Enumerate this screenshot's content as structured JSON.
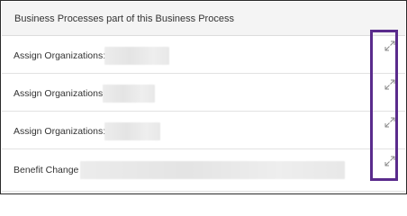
{
  "panel": {
    "title": "Business Processes part of this Business Process"
  },
  "rows": [
    {
      "label": "Assign Organizations:",
      "value": "",
      "icon": "expand-icon"
    },
    {
      "label": "Assign Organizations:",
      "value": "",
      "icon": "expand-icon"
    },
    {
      "label": "Assign Organizations:",
      "value": "",
      "icon": "expand-icon"
    },
    {
      "label": "Benefit Change -",
      "value": "",
      "icon": "expand-icon"
    }
  ],
  "colors": {
    "highlight": "#5a2b8c",
    "header_bg": "#f4f4f4",
    "text": "#333333",
    "icon": "#8a8a8a"
  }
}
